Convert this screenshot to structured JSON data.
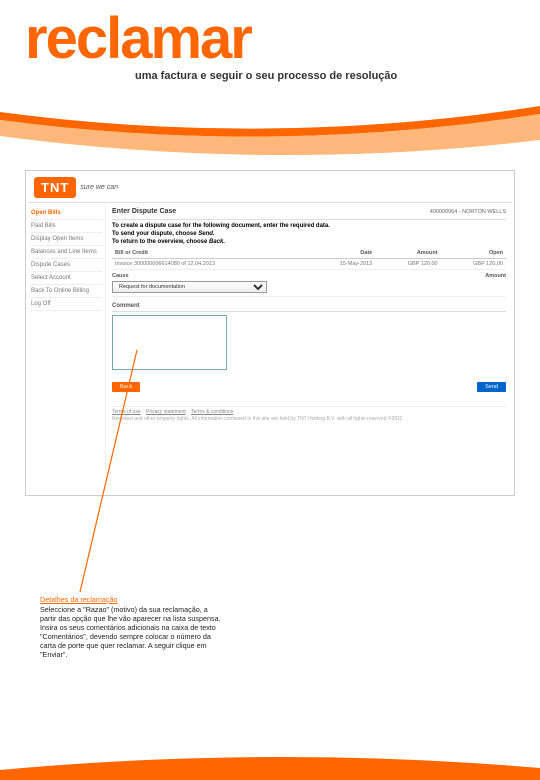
{
  "header": {
    "title": "reclamar",
    "subtitle": "uma factura e seguir o seu processo de resolução"
  },
  "app": {
    "logo": "TNT",
    "tagline": "sure we can"
  },
  "sidebar": {
    "items": [
      {
        "label": "Open Bills",
        "active": true
      },
      {
        "label": "Paid Bills",
        "active": false
      },
      {
        "label": "Display Open Items",
        "active": false
      },
      {
        "label": "Balances and Line Items",
        "active": false
      },
      {
        "label": "Dispute Cases",
        "active": false
      },
      {
        "label": "Select Account",
        "active": false
      },
      {
        "label": "Back To Online Billing",
        "active": false
      },
      {
        "label": "Log Off",
        "active": false
      }
    ]
  },
  "main": {
    "title": "Enter Dispute Case",
    "account": "400000064 - NORTON WELLS",
    "instr1": "To create a dispute case for the following document, enter the required data.",
    "instr2a": "To send your dispute, choose ",
    "instr2b": "Send.",
    "instr3a": "To return to the overview, choose ",
    "instr3b": "Back.",
    "table": {
      "headers": {
        "doc": "Bill or Credit",
        "date": "Date",
        "amount": "Amount",
        "open": "Open"
      },
      "row": {
        "doc": "Invoice 300000006614080 of 12.04.2013",
        "date": "15-May-2013",
        "amount": "GBP 120,00",
        "open": "GBP 120,00"
      }
    },
    "cause": {
      "label": "Cause",
      "amount_label": "Amount",
      "selected": "Request for documentation"
    },
    "comment_label": "Comment",
    "buttons": {
      "back": "Back",
      "send": "Send"
    },
    "footer": {
      "links": [
        "Terms of use",
        "Privacy statement",
        "Terms & conditions"
      ],
      "note": "Received and other property rights. All information contained in this site are held by TNT Holding B.V. with all rights reserved ©2011"
    }
  },
  "callout": {
    "title": "Detalhes da reclamação",
    "body": "Seleccione a \"Razao\" (motivo) da sua reclamação, a partir das  opção que lhe vão aparecer na lista suspensa. Insira os seus comentários adicionais na caixa de texto \"Comentários\", devendo sempre colocar o número da carta de porte que quer reclamar. A seguir clique em \"Enviar\"."
  }
}
